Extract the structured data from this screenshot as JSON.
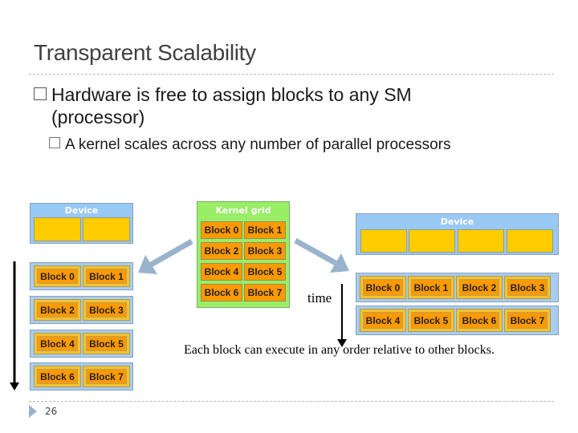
{
  "slide": {
    "title": "Transparent Scalability",
    "bullets": [
      {
        "level": 1,
        "text": "Hardware is free to assign blocks to any SM",
        "continuation": "(processor)"
      },
      {
        "level": 2,
        "text": "A kernel scales across any number of parallel processors"
      }
    ],
    "slide_number": "26"
  },
  "kernel_grid": {
    "label": "Kernel grid",
    "blocks": [
      "Block 0",
      "Block 1",
      "Block 2",
      "Block 3",
      "Block 4",
      "Block 5",
      "Block 6",
      "Block 7"
    ]
  },
  "left_device": {
    "label": "Device",
    "sm_count": 2,
    "rows": [
      [
        "Block 0",
        "Block 1"
      ],
      [
        "Block 2",
        "Block 3"
      ],
      [
        "Block 4",
        "Block 5"
      ],
      [
        "Block 6",
        "Block 7"
      ]
    ]
  },
  "right_device": {
    "label": "Device",
    "sm_count": 4,
    "rows": [
      [
        "Block 0",
        "Block 1",
        "Block 2",
        "Block 3"
      ],
      [
        "Block 4",
        "Block 5",
        "Block 6",
        "Block 7"
      ]
    ]
  },
  "time_label": "time",
  "caption": "Each block can execute in any order relative to other blocks.",
  "colors": {
    "device_blue": "#99c9f5",
    "sm_yellow": "#ffcc00",
    "block_orange": "#ff9900",
    "kernel_green": "#99ee66",
    "arrow_blue": "#9ab3cc"
  }
}
